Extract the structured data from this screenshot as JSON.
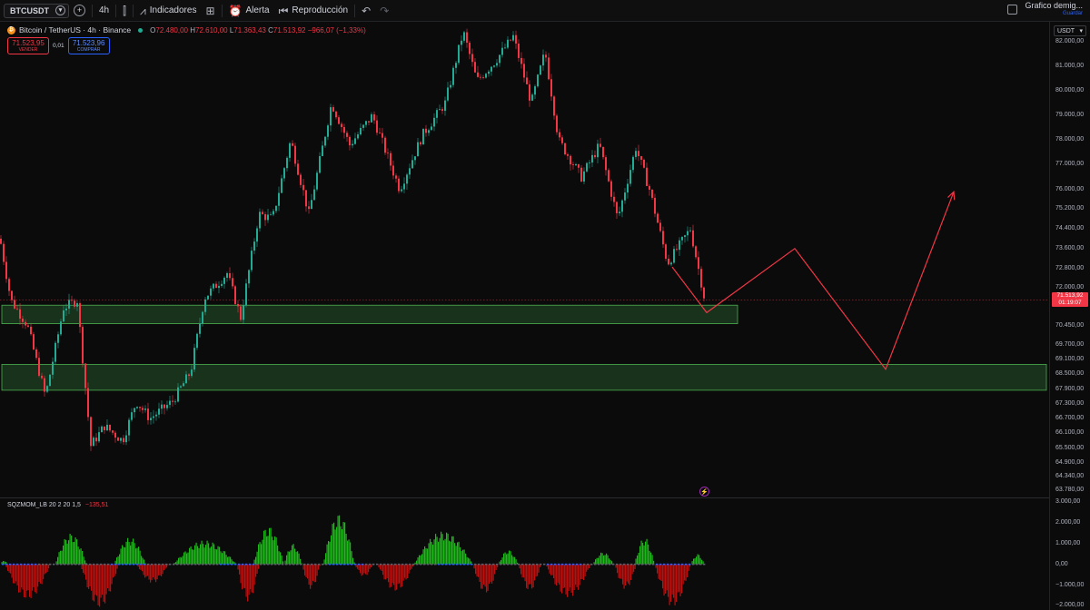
{
  "toolbar": {
    "symbol": "BTCUSDT",
    "interval": "4h",
    "indicators_label": "Indicadores",
    "alert_label": "Alerta",
    "replay_label": "Reproducción",
    "chart_name": "Grafico demig...",
    "save_label": "Guardar"
  },
  "legend": {
    "title": "Bitcoin / TetherUS · 4h · Binance",
    "open_label": "O",
    "open": "72.480,00",
    "high_label": "H",
    "high": "72.610,00",
    "low_label": "L",
    "low": "71.363,43",
    "close_label": "C",
    "close": "71.513,92",
    "change": "−966,07 (−1,33%)"
  },
  "trade": {
    "sell_price": "71.523,95",
    "sell_label": "VENDER",
    "spread": "0,01",
    "buy_price": "71.523,96",
    "buy_label": "COMPRAR"
  },
  "indicator": {
    "name": "SQZMOM_LB 20 2 20 1,5",
    "value": "−135,51"
  },
  "price_axis": {
    "currency": "USDT",
    "labels": [
      "82.000,00",
      "81.000,00",
      "80.000,00",
      "79.000,00",
      "78.000,00",
      "77.000,00",
      "76.000,00",
      "75.200,00",
      "74.400,00",
      "73.600,00",
      "72.800,00",
      "72.000,00",
      "70.450,00",
      "69.700,00",
      "69.100,00",
      "68.500,00",
      "67.900,00",
      "67.300,00",
      "66.700,00",
      "66.100,00",
      "65.500,00",
      "64.900,00",
      "64.340,00",
      "63.780,00"
    ],
    "current_price": "71.513,92",
    "countdown": "01:19:07"
  },
  "osc_axis": {
    "labels": [
      "3.000,00",
      "2.000,00",
      "1.000,00",
      "0,00",
      "−1.000,00",
      "−2.000,00"
    ]
  },
  "colors": {
    "up": "#22ab94",
    "down": "#f23645",
    "zone_fill": "#1b3a1f",
    "zone_border": "#4caf50",
    "projection": "#f23645",
    "osc_pos": "#21c21b",
    "osc_neg": "#c81010"
  },
  "chart_data": {
    "type": "candlestick",
    "instrument": "Bitcoin / TetherUS",
    "timeframe": "4h",
    "exchange": "Binance",
    "ylim": [
      63500,
      82800
    ],
    "current_price": 71513.92,
    "path": [
      [
        0,
        74000
      ],
      [
        12,
        71500
      ],
      [
        30,
        70500
      ],
      [
        50,
        67600
      ],
      [
        70,
        71200
      ],
      [
        85,
        71500
      ],
      [
        100,
        65600
      ],
      [
        115,
        66400
      ],
      [
        135,
        65800
      ],
      [
        150,
        67400
      ],
      [
        165,
        66700
      ],
      [
        190,
        67400
      ],
      [
        210,
        68600
      ],
      [
        225,
        71600
      ],
      [
        250,
        72600
      ],
      [
        265,
        70800
      ],
      [
        285,
        75000
      ],
      [
        300,
        74800
      ],
      [
        320,
        78000
      ],
      [
        340,
        75000
      ],
      [
        365,
        79500
      ],
      [
        385,
        77800
      ],
      [
        410,
        79000
      ],
      [
        440,
        76000
      ],
      [
        465,
        78200
      ],
      [
        490,
        79500
      ],
      [
        510,
        82400
      ],
      [
        525,
        80400
      ],
      [
        545,
        81200
      ],
      [
        565,
        82200
      ],
      [
        585,
        79500
      ],
      [
        600,
        81600
      ],
      [
        615,
        78000
      ],
      [
        640,
        76500
      ],
      [
        660,
        77800
      ],
      [
        680,
        74800
      ],
      [
        700,
        77700
      ],
      [
        715,
        76000
      ],
      [
        735,
        73000
      ],
      [
        760,
        74400
      ],
      [
        776,
        71500
      ]
    ],
    "zones": [
      {
        "low": 70550,
        "high": 71300
      },
      {
        "low": 67850,
        "high": 68900
      }
    ],
    "projection": [
      {
        "x": 740,
        "price": 72850
      },
      {
        "x": 778,
        "price": 71000
      },
      {
        "x": 875,
        "price": 73600
      },
      {
        "x": 975,
        "price": 68700
      },
      {
        "x": 1050,
        "price": 75900
      }
    ],
    "oscillator": {
      "ylim": [
        -2200,
        3000
      ],
      "bumps": [
        {
          "x0": 0,
          "x1": 8,
          "peak": 200
        },
        {
          "x0": 5,
          "x1": 55,
          "peak": -1700
        },
        {
          "x0": 60,
          "x1": 95,
          "peak": 1500
        },
        {
          "x0": 88,
          "x1": 130,
          "peak": -2100
        },
        {
          "x0": 125,
          "x1": 160,
          "peak": 1300
        },
        {
          "x0": 150,
          "x1": 185,
          "peak": -900
        },
        {
          "x0": 190,
          "x1": 260,
          "peak": 1150
        },
        {
          "x0": 260,
          "x1": 285,
          "peak": -1800
        },
        {
          "x0": 278,
          "x1": 312,
          "peak": 1850
        },
        {
          "x0": 312,
          "x1": 332,
          "peak": 1000
        },
        {
          "x0": 332,
          "x1": 352,
          "peak": -1200
        },
        {
          "x0": 355,
          "x1": 390,
          "peak": 2450
        },
        {
          "x0": 390,
          "x1": 410,
          "peak": -600
        },
        {
          "x0": 415,
          "x1": 455,
          "peak": -1300
        },
        {
          "x0": 455,
          "x1": 520,
          "peak": 1600
        },
        {
          "x0": 520,
          "x1": 548,
          "peak": -1400
        },
        {
          "x0": 548,
          "x1": 570,
          "peak": 700
        },
        {
          "x0": 570,
          "x1": 595,
          "peak": -1300
        },
        {
          "x0": 600,
          "x1": 650,
          "peak": -1600
        },
        {
          "x0": 652,
          "x1": 675,
          "peak": 600
        },
        {
          "x0": 676,
          "x1": 700,
          "peak": -1200
        },
        {
          "x0": 698,
          "x1": 720,
          "peak": 1300
        },
        {
          "x0": 720,
          "x1": 760,
          "peak": -2050
        },
        {
          "x0": 760,
          "x1": 775,
          "peak": 500
        }
      ]
    }
  }
}
